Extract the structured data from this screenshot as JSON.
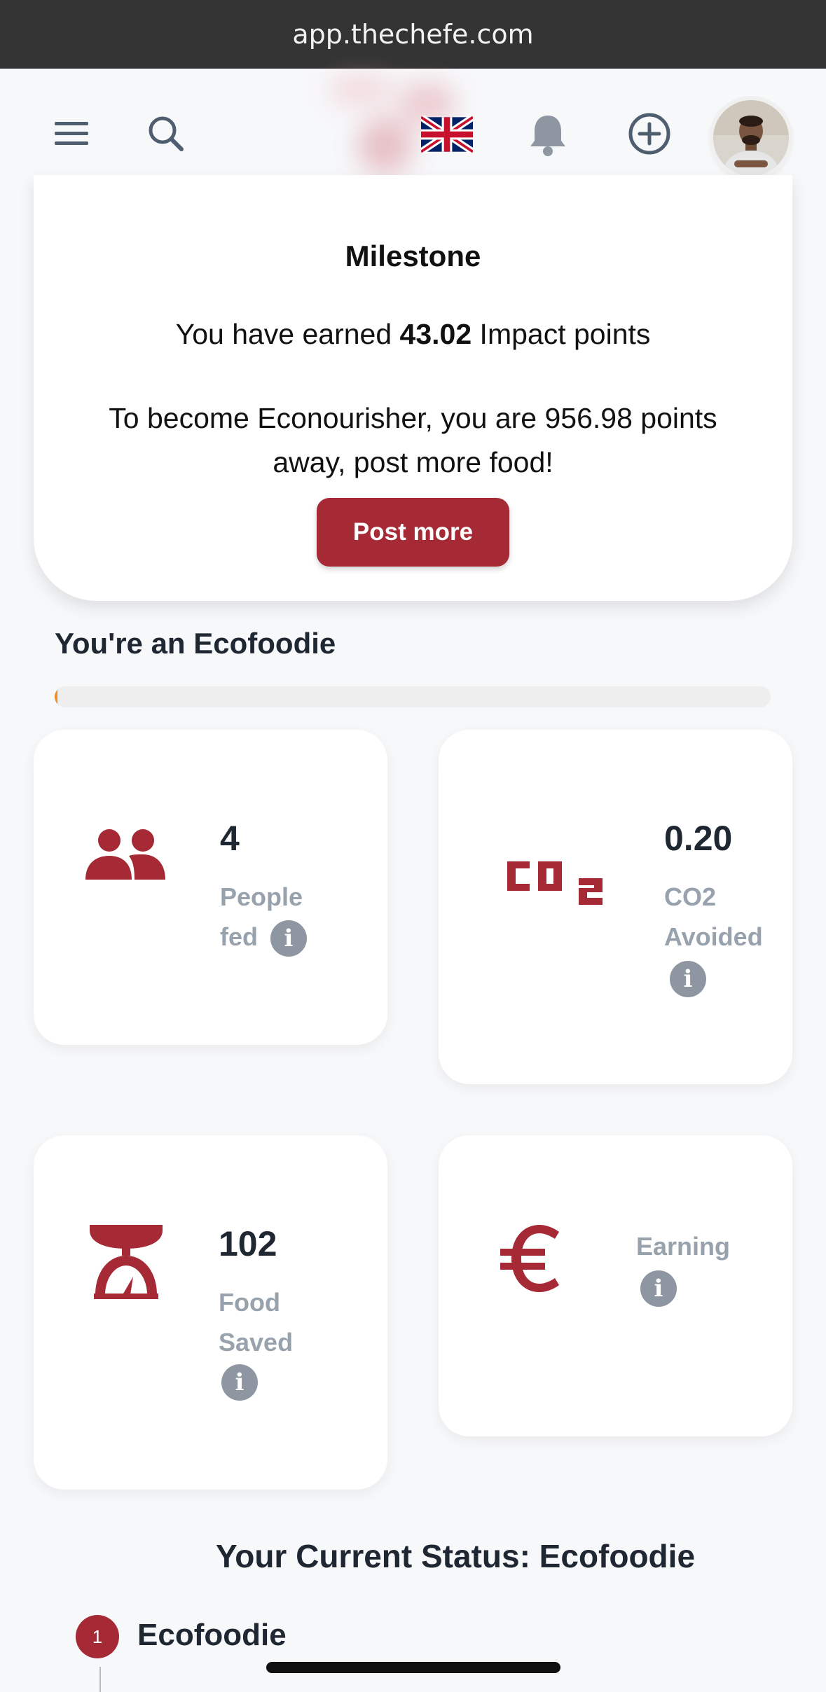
{
  "browser": {
    "url": "app.thechefe.com"
  },
  "nav": {
    "icons": [
      "menu-icon",
      "search-icon",
      "uk-flag-icon",
      "bell-icon",
      "add-circle-icon",
      "avatar"
    ]
  },
  "milestone": {
    "title": "Milestone",
    "earned_prefix": "You have earned ",
    "earned_points": "43.02",
    "earned_suffix": " Impact points",
    "away_text": "To become Econourisher, you are 956.98 points away, post more food!",
    "button_label": "Post more"
  },
  "level": {
    "heading": "You're an Ecofoodie",
    "progress_fraction": 0.0043
  },
  "stats": {
    "people": {
      "value": "4",
      "label_line1": "People",
      "label_line2": "fed"
    },
    "co2": {
      "icon_text": "CO",
      "icon_sub": "2",
      "value": "0.20",
      "label_line1": "CO2",
      "label_line2": "Avoided"
    },
    "food": {
      "value": "102",
      "label_line1": "Food",
      "label_line2": "Saved"
    },
    "earning": {
      "icon_text": "€",
      "label_line1": "Earning"
    }
  },
  "status": {
    "heading": "Your Current Status: Ecofoodie",
    "steps": [
      {
        "number": "1",
        "label": "Ecofoodie"
      }
    ]
  },
  "colors": {
    "brand": "#a52a35",
    "progress": "#f08a24",
    "muted": "#98a2ad",
    "info": "#8e97a1"
  }
}
